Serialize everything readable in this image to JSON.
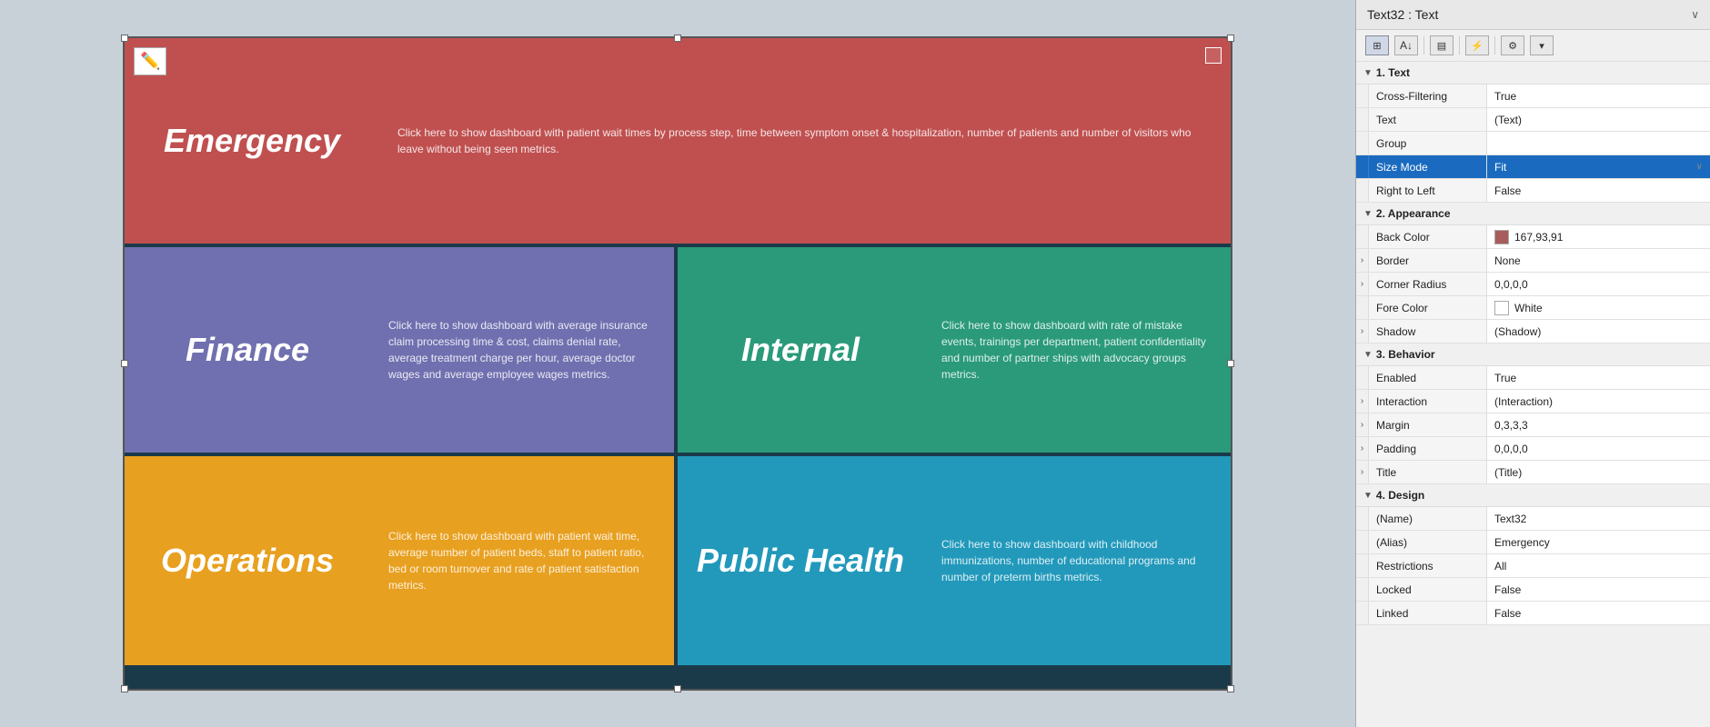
{
  "header": {
    "title": "Text32 : Text",
    "chevron": "∨"
  },
  "toolbar": {
    "icons": [
      {
        "name": "grid-icon",
        "symbol": "⊞",
        "active": true
      },
      {
        "name": "sort-icon",
        "symbol": "A↓",
        "active": false
      },
      {
        "name": "layout-icon",
        "symbol": "▤",
        "active": false
      },
      {
        "name": "bolt-icon",
        "symbol": "⚡",
        "active": false
      },
      {
        "name": "gear-icon",
        "symbol": "⚙",
        "active": false
      },
      {
        "name": "more-icon",
        "symbol": "▾",
        "active": false
      }
    ]
  },
  "sections": {
    "text": {
      "label": "1. Text",
      "properties": [
        {
          "name": "Cross-Filtering",
          "value": "True",
          "expand": false,
          "highlight": false
        },
        {
          "name": "Text",
          "value": "(Text)",
          "expand": false,
          "highlight": false
        },
        {
          "name": "Group",
          "value": "",
          "expand": false,
          "highlight": false
        },
        {
          "name": "Size Mode",
          "value": "Fit",
          "expand": false,
          "highlight": true,
          "hasDropdown": true
        },
        {
          "name": "Right to Left",
          "value": "False",
          "expand": false,
          "highlight": false
        }
      ]
    },
    "appearance": {
      "label": "2. Appearance",
      "properties": [
        {
          "name": "Back Color",
          "value": "167,93,91",
          "expand": false,
          "highlight": false,
          "hasColor": true,
          "colorHex": "#a75d5b"
        },
        {
          "name": "Border",
          "value": "None",
          "expand": true,
          "highlight": false
        },
        {
          "name": "Corner Radius",
          "value": "0,0,0,0",
          "expand": true,
          "highlight": false
        },
        {
          "name": "Fore Color",
          "value": "White",
          "expand": false,
          "highlight": false,
          "hasColor": true,
          "colorHex": "#ffffff"
        },
        {
          "name": "Shadow",
          "value": "(Shadow)",
          "expand": true,
          "highlight": false
        }
      ]
    },
    "behavior": {
      "label": "3. Behavior",
      "properties": [
        {
          "name": "Enabled",
          "value": "True",
          "expand": false,
          "highlight": false
        },
        {
          "name": "Interaction",
          "value": "(Interaction)",
          "expand": true,
          "highlight": false
        },
        {
          "name": "Margin",
          "value": "0,3,3,3",
          "expand": true,
          "highlight": false
        },
        {
          "name": "Padding",
          "value": "0,0,0,0",
          "expand": true,
          "highlight": false
        },
        {
          "name": "Title",
          "value": "(Title)",
          "expand": true,
          "highlight": false
        }
      ]
    },
    "design": {
      "label": "4. Design",
      "properties": [
        {
          "name": "(Name)",
          "value": "Text32",
          "expand": false,
          "highlight": false
        },
        {
          "name": "(Alias)",
          "value": "Emergency",
          "expand": false,
          "highlight": false
        },
        {
          "name": "Restrictions",
          "value": "All",
          "expand": false,
          "highlight": false
        },
        {
          "name": "Locked",
          "value": "False",
          "expand": false,
          "highlight": false
        },
        {
          "name": "Linked",
          "value": "False",
          "expand": false,
          "highlight": false
        }
      ]
    }
  },
  "dashboard": {
    "emergency": {
      "label": "Emergency",
      "desc": "Click here to show dashboard with patient wait times by process step, time between symptom onset & hospitalization, number of patients and number of visitors who leave without being seen metrics.",
      "color": "#c05050"
    },
    "finance": {
      "label": "Finance",
      "desc": "Click here to show dashboard with average insurance claim processing time & cost, claims denial rate, average treatment charge per hour, average doctor wages and average employee wages metrics.",
      "color": "#7070b0"
    },
    "internal": {
      "label": "Internal",
      "desc": "Click here to show dashboard with rate of mistake events, trainings per department, patient confidentiality and number of partner ships with advocacy groups metrics.",
      "color": "#2a9a7a"
    },
    "operations": {
      "label": "Operations",
      "desc": "Click here to show dashboard with patient wait time, average number of patient beds, staff to patient ratio, bed or room turnover and rate of patient satisfaction metrics.",
      "color": "#e8a020"
    },
    "publichealth": {
      "label": "Public Health",
      "desc": "Click here to show dashboard with childhood immunizations, number of educational programs and number of preterm births metrics.",
      "color": "#2299bb"
    }
  }
}
